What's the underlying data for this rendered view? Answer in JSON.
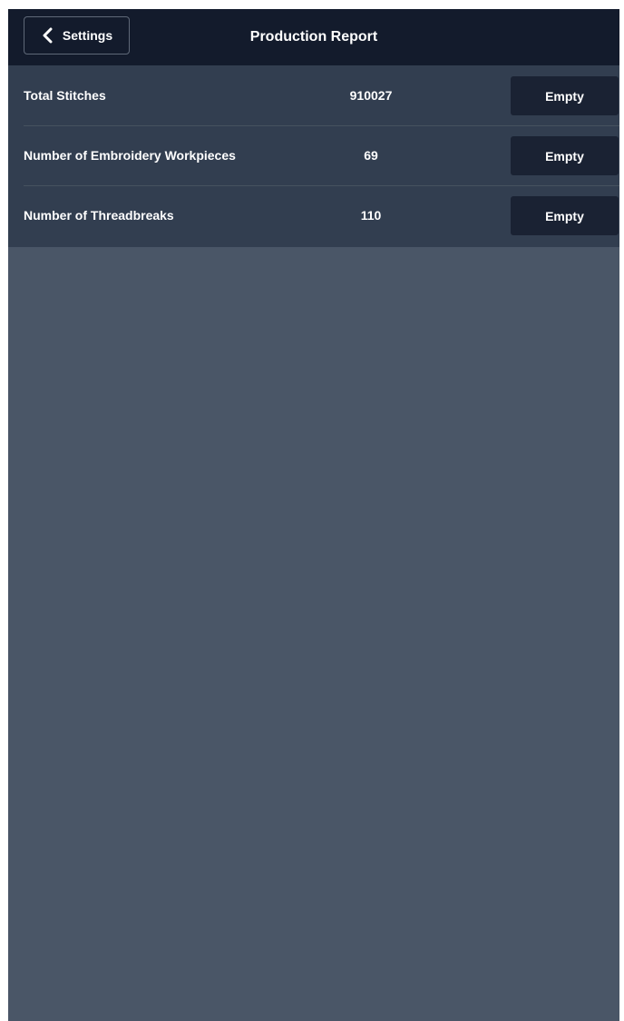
{
  "header": {
    "back_label": "Settings",
    "title": "Production Report"
  },
  "report": {
    "rows": [
      {
        "label": "Total Stitches",
        "value": "910027",
        "action": "Empty"
      },
      {
        "label": "Number of Embroidery Workpieces",
        "value": "69",
        "action": "Empty"
      },
      {
        "label": "Number of Threadbreaks",
        "value": "110",
        "action": "Empty"
      }
    ]
  },
  "icons": {
    "back": "chevron-left-icon"
  },
  "colors": {
    "navbar": "#131b2c",
    "list_background": "#323e50",
    "content_background": "#4a5667",
    "button_background": "#1a2233",
    "text": "#ffffff"
  }
}
